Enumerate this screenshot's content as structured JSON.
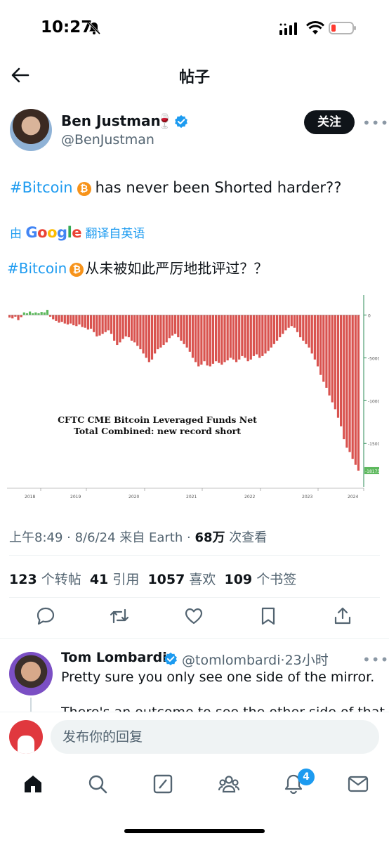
{
  "status_bar": {
    "time": "10:27",
    "icons": [
      "bell-slash-icon",
      "cellular-signal-icon",
      "wifi-icon",
      "battery-low-icon"
    ]
  },
  "header": {
    "title": "帖子",
    "back_icon": "arrow-left-icon"
  },
  "author": {
    "name": "Ben Justman",
    "emoji": "🍷",
    "handle": "@BenJustman",
    "verified": true,
    "follow_label": "关注"
  },
  "tweet": {
    "hashtag": "#Bitcoin",
    "text": "has never been Shorted harder??",
    "translate_prefix": "由",
    "translate_brand": "Google",
    "translate_suffix": "翻译自英语",
    "translated_hashtag": "#Bitcoin",
    "translated_text": "从未被如此严厉地批评过？？"
  },
  "chart_data": {
    "type": "bar",
    "title": "CFTC CME Bitcoin Leveraged Funds Net Total Combined: new record short",
    "x_tick_labels": [
      "2018",
      "2019",
      "2020",
      "2021",
      "2022",
      "2023",
      "2024"
    ],
    "y_tick_labels": [
      "0",
      "-5000",
      "-10000",
      "-15000"
    ],
    "ylim": [
      -19000,
      2000
    ],
    "last_value_label": "-18175",
    "colors": {
      "negative": "#d9534f",
      "positive": "#5cb85c",
      "axis": "#2e8b57"
    },
    "series": [
      {
        "values": [
          -300,
          -400,
          -200,
          -600,
          -250,
          300,
          200,
          400,
          200,
          300,
          200,
          350,
          300,
          600,
          -200,
          -500,
          -700,
          -900,
          -800,
          -1000,
          -1100,
          -1000,
          -1200,
          -1300,
          -1100,
          -1400,
          -1500,
          -1700,
          -1600,
          -2000,
          -2500,
          -2400,
          -2200,
          -2000,
          -1800,
          -2200,
          -3000,
          -3500,
          -3200,
          -2800,
          -2500,
          -2600,
          -3000,
          -3200,
          -3600,
          -4000,
          -4500,
          -5000,
          -5500,
          -5200,
          -4500,
          -4000,
          -3800,
          -3500,
          -3200,
          -2700,
          -2400,
          -2200,
          -2600,
          -3000,
          -3400,
          -3800,
          -4300,
          -5000,
          -5500,
          -6000,
          -5800,
          -5400,
          -5900,
          -6000,
          -5700,
          -5400,
          -5600,
          -5800,
          -5500,
          -5300,
          -5000,
          -5200,
          -5500,
          -5200,
          -4800,
          -5000,
          -5400,
          -5200,
          -4800,
          -4600,
          -5000,
          -4800,
          -4500,
          -4200,
          -3800,
          -3400,
          -3000,
          -2600,
          -2200,
          -1800,
          -1500,
          -1300,
          -1500,
          -2000,
          -2600,
          -3000,
          -3400,
          -3800,
          -4500,
          -5200,
          -6000,
          -7000,
          -7800,
          -8500,
          -9400,
          -10200,
          -11000,
          -12000,
          -13000,
          -14500,
          -15500,
          -16000,
          -16800,
          -17500,
          -18175
        ]
      }
    ],
    "grid": false,
    "legend": "none"
  },
  "meta": {
    "time": "上午8:49",
    "date": "8/6/24",
    "source_prefix": "来自",
    "source": "Earth",
    "views": "68万",
    "views_label": "次查看"
  },
  "stats": {
    "reposts": "123",
    "reposts_label": "个转帖",
    "quotes": "41",
    "quotes_label": "引用",
    "likes": "1057",
    "likes_label": "喜欢",
    "bookmarks": "109",
    "bookmarks_label": "个书签"
  },
  "actions": [
    "reply-icon",
    "retweet-icon",
    "heart-icon",
    "bookmark-icon",
    "share-icon"
  ],
  "reply": {
    "name": "Tom Lombardi",
    "handle": "@tomlombardi",
    "time": "23小时",
    "text": "Pretty sure you only see one side of the mirror.",
    "text2": "There's an outcome to see the other side of that"
  },
  "compose": {
    "placeholder": "发布你的回复"
  },
  "tab_bar": {
    "items": [
      "home-icon",
      "search-icon",
      "grok-icon",
      "communities-icon",
      "notifications-icon",
      "messages-icon"
    ],
    "notification_count": "4"
  }
}
